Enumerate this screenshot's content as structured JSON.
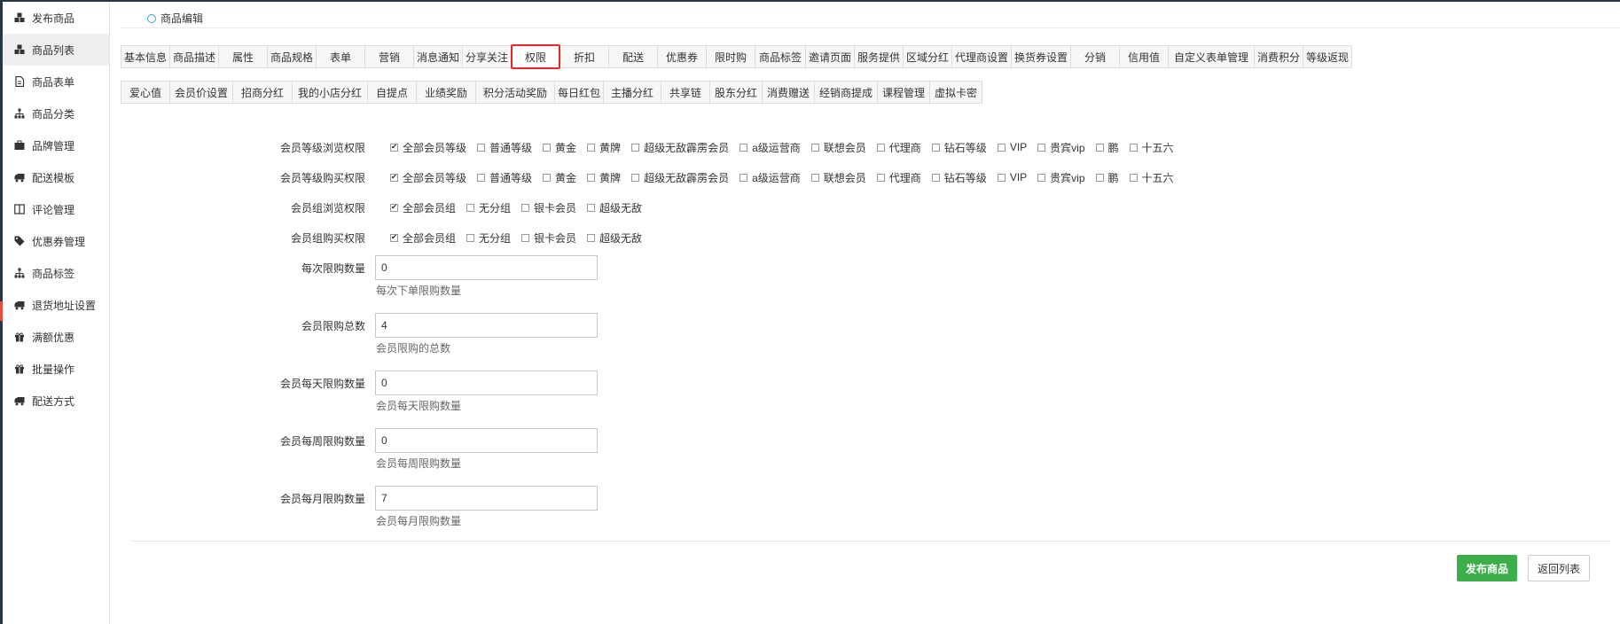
{
  "sidebar": {
    "items": [
      {
        "label": "发布商品",
        "icon": "cubes-icon"
      },
      {
        "label": "商品列表",
        "icon": "cubes-icon"
      },
      {
        "label": "商品表单",
        "icon": "file-icon"
      },
      {
        "label": "商品分类",
        "icon": "sitemap-icon"
      },
      {
        "label": "品牌管理",
        "icon": "briefcase-icon"
      },
      {
        "label": "配送模板",
        "icon": "truck-icon"
      },
      {
        "label": "评论管理",
        "icon": "columns-icon"
      },
      {
        "label": "优惠券管理",
        "icon": "tags-icon"
      },
      {
        "label": "商品标签",
        "icon": "sitemap-icon"
      },
      {
        "label": "退货地址设置",
        "icon": "truck-icon"
      },
      {
        "label": "满额优惠",
        "icon": "gift-icon"
      },
      {
        "label": "批量操作",
        "icon": "gift-icon"
      },
      {
        "label": "配送方式",
        "icon": "truck-icon"
      }
    ],
    "active_index": 1
  },
  "breadcrumb": {
    "label": "商品编辑"
  },
  "tabs_row1": [
    "基本信息",
    "商品描述",
    "属性",
    "商品规格",
    "表单",
    "营销",
    "消息通知",
    "分享关注",
    "权限",
    "折扣",
    "配送",
    "优惠券",
    "限时购",
    "商品标签",
    "邀请页面",
    "服务提供",
    "区域分红",
    "代理商设置",
    "换货券设置",
    "分销",
    "信用值",
    "自定义表单管理",
    "消费积分",
    "等级返现"
  ],
  "tabs_row2": [
    "爱心值",
    "会员价设置",
    "招商分红",
    "我的小店分红",
    "自提点",
    "业绩奖励",
    "积分活动奖励",
    "每日红包",
    "主播分红",
    "共享链",
    "股东分红",
    "消费赠送",
    "经销商提成",
    "课程管理",
    "虚拟卡密"
  ],
  "active_tab": "权限",
  "permissions": [
    {
      "label": "会员等级浏览权限",
      "options": [
        {
          "text": "全部会员等级",
          "checked": true
        },
        {
          "text": "普通等级",
          "checked": false
        },
        {
          "text": "黄金",
          "checked": false
        },
        {
          "text": "黄牌",
          "checked": false
        },
        {
          "text": "超级无敌霹雳会员",
          "checked": false
        },
        {
          "text": "a级运营商",
          "checked": false
        },
        {
          "text": "联想会员",
          "checked": false
        },
        {
          "text": "代理商",
          "checked": false
        },
        {
          "text": "钻石等级",
          "checked": false
        },
        {
          "text": "VIP",
          "checked": false
        },
        {
          "text": "贵宾vip",
          "checked": false
        },
        {
          "text": "鹏",
          "checked": false
        },
        {
          "text": "十五六",
          "checked": false
        }
      ]
    },
    {
      "label": "会员等级购买权限",
      "options": [
        {
          "text": "全部会员等级",
          "checked": true
        },
        {
          "text": "普通等级",
          "checked": false
        },
        {
          "text": "黄金",
          "checked": false
        },
        {
          "text": "黄牌",
          "checked": false
        },
        {
          "text": "超级无敌霹雳会员",
          "checked": false
        },
        {
          "text": "a级运营商",
          "checked": false
        },
        {
          "text": "联想会员",
          "checked": false
        },
        {
          "text": "代理商",
          "checked": false
        },
        {
          "text": "钻石等级",
          "checked": false
        },
        {
          "text": "VIP",
          "checked": false
        },
        {
          "text": "贵宾vip",
          "checked": false
        },
        {
          "text": "鹏",
          "checked": false
        },
        {
          "text": "十五六",
          "checked": false
        }
      ]
    },
    {
      "label": "会员组浏览权限",
      "options": [
        {
          "text": "全部会员组",
          "checked": true
        },
        {
          "text": "无分组",
          "checked": false
        },
        {
          "text": "银卡会员",
          "checked": false
        },
        {
          "text": "超级无敌",
          "checked": false
        }
      ]
    },
    {
      "label": "会员组购买权限",
      "options": [
        {
          "text": "全部会员组",
          "checked": true
        },
        {
          "text": "无分组",
          "checked": false
        },
        {
          "text": "银卡会员",
          "checked": false
        },
        {
          "text": "超级无敌",
          "checked": false
        }
      ]
    }
  ],
  "limits": [
    {
      "label": "每次限购数量",
      "value": "0",
      "hint": "每次下单限购数量"
    },
    {
      "label": "会员限购总数",
      "value": "4",
      "hint": "会员限购的总数"
    },
    {
      "label": "会员每天限购数量",
      "value": "0",
      "hint": "会员每天限购数量"
    },
    {
      "label": "会员每周限购数量",
      "value": "0",
      "hint": "会员每周限购数量"
    },
    {
      "label": "会员每月限购数量",
      "value": "7",
      "hint": "会员每月限购数量"
    }
  ],
  "buttons": {
    "publish": "发布商品",
    "back": "返回列表"
  },
  "colors": {
    "accent": "#3ea0d8",
    "active_tab_border": "#e8262a",
    "publish_bg": "#3cae4a",
    "sidebar_dark": "#2a3542"
  }
}
